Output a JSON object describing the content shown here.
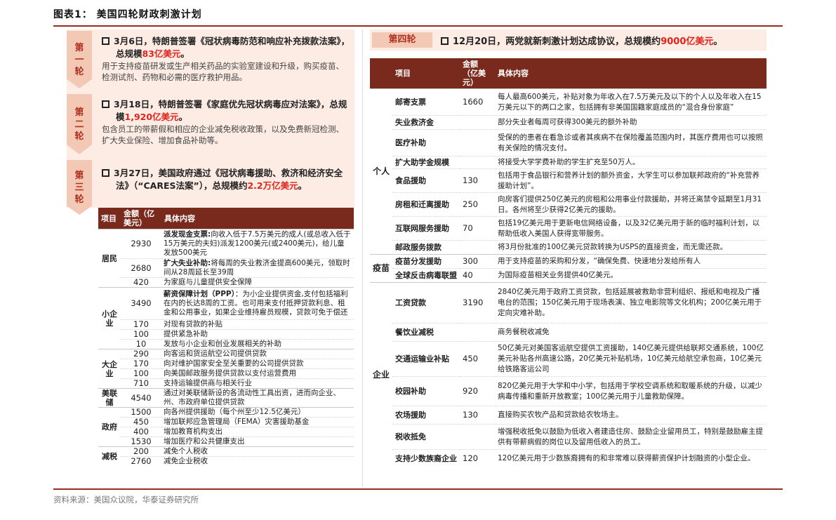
{
  "title": "图表1：  美国四轮财政刺激计划",
  "source": "资料来源：美国众议院，华泰证券研究所",
  "rounds": [
    {
      "label": "第一轮",
      "head_a": "3月6日，特朗普签署《冠状病毒防范和响应补充拨款法案》，总规模",
      "amount": "83亿美元",
      "head_b": "。",
      "desc": "用于支持疫苗研发或生产相关药品的实验室建设和升级，购买疫苗、检测试剂、药物和必需的医疗救护用品。"
    },
    {
      "label": "第二轮",
      "head_a": "3月18日，特朗普签署《家庭优先冠状病毒应对法案》，总规模",
      "amount": "1,920亿美元",
      "head_b": "。",
      "desc": "包含员工的带薪假和相应的企业减免税收政策，以及免费新冠检测、扩大失业保险、增加食品补助等。"
    },
    {
      "label": "第三轮",
      "head_a": "3月27日，美国政府通过《冠状病毒援助、救济和经济安全法》（“CARES法案”），总规模约",
      "amount": "2.2万亿美元",
      "head_b": "。",
      "desc": ""
    }
  ],
  "left_table": {
    "headers": [
      "项目",
      "金额（亿美元）",
      "具体内容"
    ],
    "groups": [
      {
        "cat": "居民",
        "rows": [
          {
            "num": "2930",
            "bold": "派发现金支票:",
            "text": "向收入低于7.5万美元的成人(或总收入低于15万美元的夫妇)派发1200美元(或2400美元)，给儿童发放500美元"
          },
          {
            "num": "2680",
            "bold": "扩大失业补助:",
            "text": "将每周的失业救济金提高600美元，领取时间从28周延长至39周"
          },
          {
            "num": "420",
            "bold": "",
            "text": "为家庭与儿童提供安全保障"
          }
        ]
      },
      {
        "cat": "小企业",
        "rows": [
          {
            "num": "3490",
            "bold": "薪资保障计划（PPP）",
            "text": "：为小企业提供资金,支付包括福利在内的长达8周的工资。也可用来支付抵押贷款利息、租金和公用事业，如果企业维持雇员规模，贷款可免于偿还"
          },
          {
            "num": "170",
            "bold": "",
            "text": "对现有贷款的补贴"
          },
          {
            "num": "100",
            "bold": "",
            "text": "提供紧急补助"
          },
          {
            "num": "10",
            "bold": "",
            "text": "发放与小企业和创业发展相关的补助"
          }
        ]
      },
      {
        "cat": "大企业",
        "rows": [
          {
            "num": "290",
            "bold": "",
            "text": "向客运和货运航空公司提供贷款"
          },
          {
            "num": "170",
            "bold": "",
            "text": "向对维护国家安全至关重要的公司提供贷款"
          },
          {
            "num": "100",
            "bold": "",
            "text": "向美国邮政服务提供贷款以支付运营费用"
          },
          {
            "num": "710",
            "bold": "",
            "text": "支持运输提供商与相关行业"
          }
        ]
      },
      {
        "cat": "美联储",
        "rows": [
          {
            "num": "4540",
            "bold": "",
            "text": "通过对美联储新设的各流动性工具出资，进而向企业、州、市政府单位提供贷款"
          }
        ]
      },
      {
        "cat": "政府",
        "rows": [
          {
            "num": "1500",
            "bold": "",
            "text": "向各州提供援助（每个州至少12.5亿美元）"
          },
          {
            "num": "450",
            "bold": "",
            "text": "增加联邦应急管理局（FEMA）灾害援助基金"
          },
          {
            "num": "400",
            "bold": "",
            "text": "增加教育机构支出"
          },
          {
            "num": "1530",
            "bold": "",
            "text": "增加医疗和公共健康支出"
          }
        ]
      },
      {
        "cat": "减税",
        "rows": [
          {
            "num": "200",
            "bold": "",
            "text": "减免个人税收"
          },
          {
            "num": "2760",
            "bold": "",
            "text": "减免企业税收"
          }
        ]
      }
    ]
  },
  "round4": {
    "label": "第四轮",
    "head_a": "12月20日，两党就新刺激计划达成协议，总规模约",
    "amount": "9000亿美元",
    "head_b": "。"
  },
  "right_table": {
    "headers": [
      "项目",
      "金额（亿美元）",
      "具体内容"
    ],
    "groups": [
      {
        "cat": "个人",
        "rows": [
          {
            "name": "邮寄支票",
            "num": "1660",
            "text": "每人最高600美元，补贴对象为年收入在7.5万美元及以下的个人以及年收入在15万美元以下的两口之家，包括拥有非美国国籍家庭成员的“混合身份家庭”"
          },
          {
            "name": "失业救济金",
            "num": "",
            "text": "部分失业者每周可获得300美元的额外补助"
          },
          {
            "name": "医疗补助",
            "num": "",
            "text": "受保的的患者在看急诊或者其疾病不在保险覆盖范围内时，其医疗费用也可以按照有关保险的情况支付。"
          },
          {
            "name": "扩大助学金规模",
            "num": "",
            "text": "将接受大学学费补助的学生扩充至50万人。"
          },
          {
            "name": "食品援助",
            "num": "130",
            "text": "包括用于食品银行和营养计划的额外资金，大学生可以参加联邦政府的“补充营养援助计划”。"
          },
          {
            "name": "房租和迁离援助",
            "num": "250",
            "text": "向房客们提供250亿美元的房租和公用事业付款援助，并将迁离禁令延期至1月31日。各州将至少获得2亿美元的援助。"
          },
          {
            "name": "互联网服务援助",
            "num": "70",
            "text": "包括19亿美元用于更新电信网络设备，以及32亿美元用于新的临时福利计划，以帮助低收入美国人获得宽带服务。"
          },
          {
            "name": "邮政服务拨款",
            "num": "",
            "text": "将3月份批准的100亿美元贷款转换为USPS的直接资金，而无需还款。"
          }
        ]
      },
      {
        "cat": "疫苗",
        "rows": [
          {
            "name": "疫苗分发援助",
            "num": "300",
            "text": "用于支持疫苗的采购和分发，“确保免费、快速地分发给所有人"
          },
          {
            "name": "全球反击病毒联盟",
            "num": "40",
            "text": "为国际疫苗相关业务提供40亿美元。"
          }
        ]
      },
      {
        "cat": "企业",
        "rows": [
          {
            "name": "工资贷款",
            "num": "3190",
            "text": "2840亿美元用于政府工资贷款，包括延展被救助非营利组织、报纸和电视及广播电台的范围；150亿美元用于现场表演、独立电影院等文化机构；200亿美元用于定向灾难补助。"
          },
          {
            "name": "餐饮业减税",
            "num": "",
            "text": "商务餐税收减免"
          },
          {
            "name": "交通运输业补贴",
            "num": "450",
            "text": "50亿美元对美国客运航空提供工资援助，140亿美元提供给联邦交通系统，100亿美元补贴各州高速公路，20亿美元补贴机场，10亿美元给航空承包商，10亿美元给铁路客运公司"
          },
          {
            "name": "校园补助",
            "num": "920",
            "text": "820亿美元用于大学和中小学，包括用于学校空调系统和取暖系统的升级，以减少病毒传播和重新开放教室；100亿美元用于儿童救助保障。"
          },
          {
            "name": "农场援助",
            "num": "130",
            "text": "直接购买农牧产品和贷款给农牧场主。"
          },
          {
            "name": "税收抵免",
            "num": "",
            "text": "增强税收抵免以鼓励为低收入者建造住房、鼓励企业留用员工，特别是鼓励雇主提供有带薪病假的岗位以及留用低收入的员工。"
          },
          {
            "name": "支持少数族裔企业",
            "num": "120",
            "text": "120亿美元用于少数族裔拥有的和非常难以获得薪资保护计划融资的小型企业。"
          }
        ]
      }
    ]
  },
  "colors": {
    "accent": "#9b2a1f",
    "table_header": "#7a2a1c",
    "amount_red": "#e0231c",
    "chevron": "#f3c9b6",
    "panel": "#fcece4"
  }
}
